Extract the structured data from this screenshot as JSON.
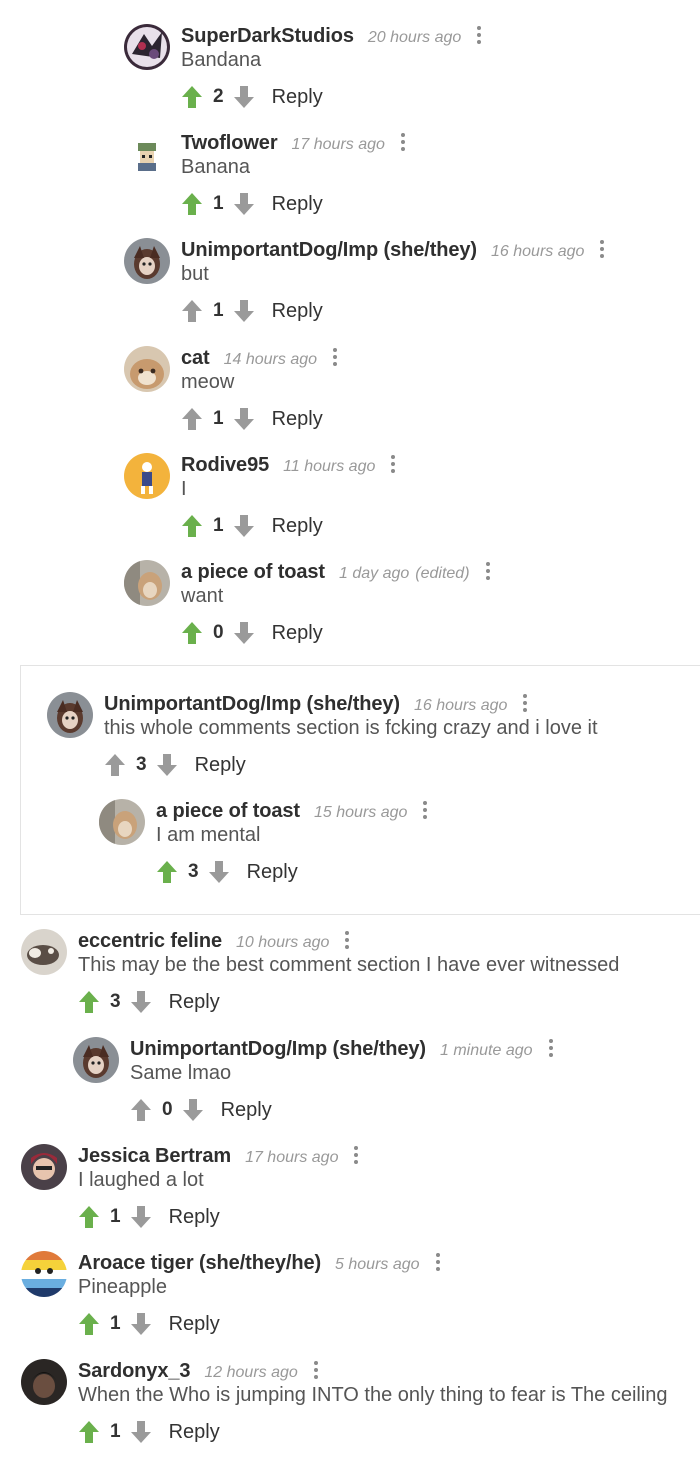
{
  "colors": {
    "upvote_active": "#6ab04c",
    "upvote_inactive": "#9a9a9a",
    "downvote": "#9a9a9a"
  },
  "comments": [
    {
      "author": "SuperDarkStudios",
      "time": "20 hours ago",
      "edited": "",
      "text": "Bandana",
      "score": "2",
      "upvoted": true,
      "avatar": "superdark"
    },
    {
      "author": "Twoflower",
      "time": "17 hours ago",
      "edited": "",
      "text": "Banana",
      "score": "1",
      "upvoted": true,
      "avatar": "twoflower"
    },
    {
      "author": "UnimportantDog/Imp (she/they)",
      "time": "16 hours ago",
      "edited": "",
      "text": "but",
      "score": "1",
      "upvoted": false,
      "avatar": "dog"
    },
    {
      "author": "cat",
      "time": "14 hours ago",
      "edited": "",
      "text": "meow",
      "score": "1",
      "upvoted": false,
      "avatar": "cat"
    },
    {
      "author": "Rodive95",
      "time": "11 hours ago",
      "edited": "",
      "text": "I",
      "score": "1",
      "upvoted": true,
      "avatar": "rodive"
    },
    {
      "author": "a piece of toast",
      "time": "1 day ago",
      "edited": "(edited)",
      "text": "want",
      "score": "0",
      "upvoted": true,
      "avatar": "toast"
    },
    {
      "author": "UnimportantDog/Imp (she/they)",
      "time": "16 hours ago",
      "edited": "",
      "text": "this whole comments section is fcking crazy and i love it",
      "score": "3",
      "upvoted": false,
      "avatar": "dog"
    },
    {
      "author": "a piece of toast",
      "time": "15 hours ago",
      "edited": "",
      "text": "I am mental",
      "score": "3",
      "upvoted": true,
      "avatar": "toast"
    },
    {
      "author": "eccentric feline",
      "time": "10 hours ago",
      "edited": "",
      "text": "This may be the best comment section I have ever witnessed",
      "score": "3",
      "upvoted": true,
      "avatar": "feline"
    },
    {
      "author": "UnimportantDog/Imp (she/they)",
      "time": "1 minute ago",
      "edited": "",
      "text": "Same lmao",
      "score": "0",
      "upvoted": false,
      "avatar": "dog"
    },
    {
      "author": "Jessica Bertram",
      "time": "17 hours ago",
      "edited": "",
      "text": "I laughed a lot",
      "score": "1",
      "upvoted": true,
      "avatar": "jessica"
    },
    {
      "author": "Aroace tiger (she/they/he)",
      "time": "5 hours ago",
      "edited": "",
      "text": "Pineapple",
      "score": "1",
      "upvoted": true,
      "avatar": "aroace"
    },
    {
      "author": "Sardonyx_3",
      "time": "12 hours ago",
      "edited": "",
      "text": "When the Who is jumping INTO the only thing to fear is The ceiling",
      "score": "1",
      "upvoted": true,
      "avatar": "sardonyx"
    }
  ],
  "reply_label": "Reply"
}
